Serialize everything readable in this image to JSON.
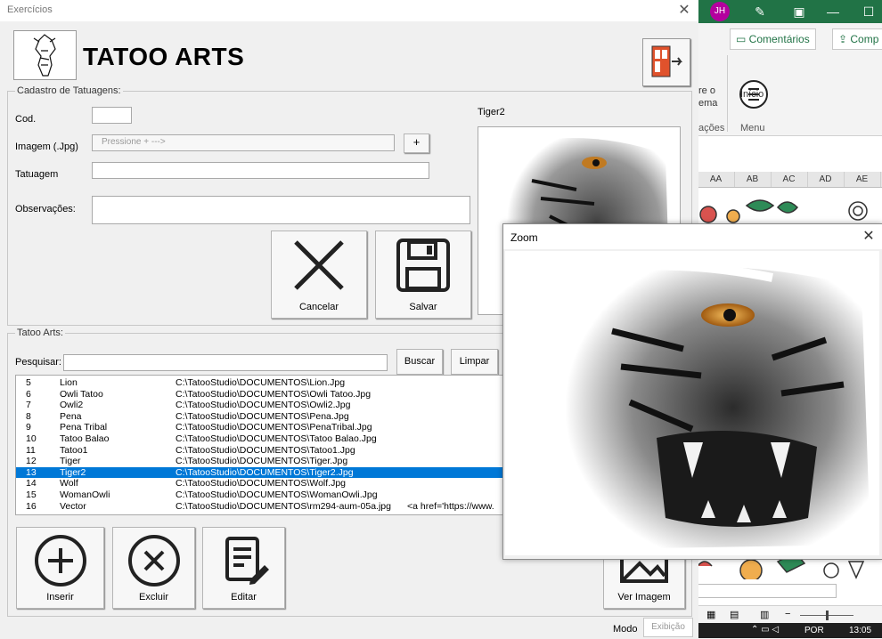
{
  "excel": {
    "avatar_initials": "JH",
    "comments_button": "Comentários",
    "share_button": "Comp",
    "ribbon_partial_top": "re o",
    "ribbon_partial_mid": "ema",
    "ribbon_group_partial": "ações",
    "inicio_label": "Início",
    "menu_label": "Menu",
    "columns": [
      "AA",
      "AB",
      "AC",
      "AD",
      "AE"
    ],
    "taskbar_lang": "POR",
    "taskbar_time": "13:05",
    "accent_color": "#217346"
  },
  "window": {
    "title": "Exercícios",
    "close_icon": "close-icon"
  },
  "header": {
    "app_title": "TATOO ARTS"
  },
  "form": {
    "frame_title": "Cadastro de Tatuagens:",
    "cod_label": "Cod.",
    "cod_value": "",
    "imagem_label": "Imagem (.Jpg)",
    "imagem_placeholder": "Pressione + --->",
    "add_button": "+",
    "tatuagem_label": "Tatuagem",
    "tatuagem_value": "",
    "observacoes_label": "Observações:",
    "observacoes_value": "",
    "cancel_button": "Cancelar",
    "save_button": "Salvar",
    "preview_caption": "Tiger2"
  },
  "list_section": {
    "frame_title": "Tatoo Arts:",
    "search_label": "Pesquisar:",
    "search_value": "",
    "search_button": "Buscar",
    "clear_button": "Limpar",
    "rows": [
      {
        "id": "5",
        "name": "Lion",
        "path": "C:\\TatooStudio\\DOCUMENTOS\\Lion.Jpg",
        "extra": ""
      },
      {
        "id": "6",
        "name": "Owli Tatoo",
        "path": "C:\\TatooStudio\\DOCUMENTOS\\Owli Tatoo.Jpg",
        "extra": ""
      },
      {
        "id": "7",
        "name": "Owli2",
        "path": "C:\\TatooStudio\\DOCUMENTOS\\Owli2.Jpg",
        "extra": ""
      },
      {
        "id": "8",
        "name": "Pena",
        "path": "C:\\TatooStudio\\DOCUMENTOS\\Pena.Jpg",
        "extra": ""
      },
      {
        "id": "9",
        "name": "Pena Tribal",
        "path": "C:\\TatooStudio\\DOCUMENTOS\\PenaTribal.Jpg",
        "extra": ""
      },
      {
        "id": "10",
        "name": "Tatoo Balao",
        "path": "C:\\TatooStudio\\DOCUMENTOS\\Tatoo Balao.Jpg",
        "extra": ""
      },
      {
        "id": "11",
        "name": "Tatoo1",
        "path": "C:\\TatooStudio\\DOCUMENTOS\\Tatoo1.Jpg",
        "extra": ""
      },
      {
        "id": "12",
        "name": "Tiger",
        "path": "C:\\TatooStudio\\DOCUMENTOS\\Tiger.Jpg",
        "extra": ""
      },
      {
        "id": "13",
        "name": "Tiger2",
        "path": "C:\\TatooStudio\\DOCUMENTOS\\Tiger2.Jpg",
        "extra": ""
      },
      {
        "id": "14",
        "name": "Wolf",
        "path": "C:\\TatooStudio\\DOCUMENTOS\\Wolf.Jpg",
        "extra": ""
      },
      {
        "id": "15",
        "name": "WomanOwli",
        "path": "C:\\TatooStudio\\DOCUMENTOS\\WomanOwli.Jpg",
        "extra": ""
      },
      {
        "id": "16",
        "name": "Vector",
        "path": "C:\\TatooStudio\\DOCUMENTOS\\rm294-aum-05a.jpg",
        "extra": "<a href='https://www."
      }
    ],
    "selected_id": "13",
    "selection_color": "#0078d7"
  },
  "actions": {
    "insert_button": "Inserir",
    "delete_button": "Excluir",
    "edit_button": "Editar",
    "view_image_button": "Ver Imagem"
  },
  "mode": {
    "label": "Modo",
    "value": "Exibição"
  },
  "zoom": {
    "title": "Zoom"
  }
}
